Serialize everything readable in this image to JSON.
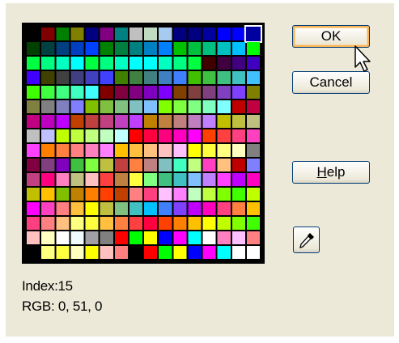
{
  "buttons": {
    "ok": "OK",
    "cancel": "Cancel",
    "help_underlined": "H",
    "help_rest": "elp"
  },
  "info": {
    "index_label": "Index:",
    "index_value": "15",
    "rgb_label": "RGB:",
    "rgb_value": "0, 51, 0"
  },
  "palette": {
    "columns": 16,
    "rows": 16,
    "selected_index": 15,
    "icon": "eyedropper-icon",
    "colors": [
      [
        "#000000",
        "#800000",
        "#008000",
        "#808000",
        "#000080",
        "#800080",
        "#008080",
        "#c0c0c0",
        "#c0dcc0",
        "#a6caf0",
        "#000080",
        "#000080",
        "#0000a0",
        "#0000ff",
        "#0000ff",
        "#003300"
      ],
      [
        "#004000",
        "#004040",
        "#004080",
        "#0040c0",
        "#0040ff",
        "#008000",
        "#008040",
        "#008080",
        "#0080c0",
        "#0080ff",
        "#00c000",
        "#00c040",
        "#00c080",
        "#00c0c0",
        "#00c0ff",
        "#00ff00"
      ],
      [
        "#00ff40",
        "#00ff80",
        "#00ffc0",
        "#00ffff",
        "#00ff40",
        "#00ff80",
        "#00ffc0",
        "#00ffff",
        "#00ffff",
        "#00ffc0",
        "#00ff80",
        "#00ff40",
        "#400000",
        "#400040",
        "#400080",
        "#4000c0"
      ],
      [
        "#4000ff",
        "#404000",
        "#404040",
        "#404080",
        "#4040c0",
        "#4040ff",
        "#408000",
        "#408040",
        "#408080",
        "#4080c0",
        "#4080ff",
        "#40c000",
        "#40c040",
        "#40c080",
        "#40c0c0",
        "#40c0ff"
      ],
      [
        "#40ff00",
        "#40ff40",
        "#40ff80",
        "#40ffc0",
        "#40ffff",
        "#800000",
        "#800040",
        "#800080",
        "#8000c0",
        "#8000ff",
        "#804000",
        "#804040",
        "#804080",
        "#8040c0",
        "#8040ff",
        "#808000"
      ],
      [
        "#808040",
        "#808080",
        "#8080c0",
        "#8080ff",
        "#80c000",
        "#80c040",
        "#80c080",
        "#80c0c0",
        "#80c0ff",
        "#80ff00",
        "#80ff40",
        "#80ff80",
        "#80ffc0",
        "#80ffff",
        "#c00000",
        "#c00040"
      ],
      [
        "#c00080",
        "#c000c0",
        "#c000ff",
        "#c04000",
        "#c04040",
        "#c04080",
        "#c040c0",
        "#c040ff",
        "#c08000",
        "#c08040",
        "#c08080",
        "#c080c0",
        "#c080ff",
        "#c0c000",
        "#c0c040",
        "#c0c080"
      ],
      [
        "#c0c0c0",
        "#c0c0ff",
        "#c0ff00",
        "#c0ff40",
        "#c0ff80",
        "#c0ffc0",
        "#c0ffff",
        "#ff0000",
        "#ff0040",
        "#ff0080",
        "#ff00c0",
        "#ff00ff",
        "#ff4000",
        "#ff4040",
        "#ff4080",
        "#ff40c0"
      ],
      [
        "#ff40ff",
        "#ff8000",
        "#ff8040",
        "#ff8080",
        "#ff80c0",
        "#ff80ff",
        "#ffc000",
        "#ffc040",
        "#ffc080",
        "#ffc0c0",
        "#ffc0ff",
        "#ffff00",
        "#ffff40",
        "#ffff80",
        "#ffffc0",
        "#808080"
      ],
      [
        "#800040",
        "#804080",
        "#8000c0",
        "#40c040",
        "#80ff40",
        "#c0c040",
        "#c04040",
        "#ff8040",
        "#c08080",
        "#80c0c0",
        "#40ffc0",
        "#c0ff80",
        "#ff40c0",
        "#ffc080",
        "#c00000",
        "#8080ff"
      ],
      [
        "#c04080",
        "#ff0080",
        "#ff80c0",
        "#c0c080",
        "#ffc0c0",
        "#ff4040",
        "#c08040",
        "#ffff40",
        "#80ff80",
        "#40c080",
        "#40c0c0",
        "#80c0ff",
        "#c080ff",
        "#ff40ff",
        "#c000ff",
        "#ff00c0"
      ],
      [
        "#c0c000",
        "#ffc000",
        "#80c000",
        "#c08000",
        "#ff8000",
        "#ff4000",
        "#c04000",
        "#ff8080",
        "#ff4080",
        "#ffc0ff",
        "#ff80ff",
        "#c0ffc0",
        "#c0ff40",
        "#80ff00",
        "#40ff00",
        "#c0ff00"
      ],
      [
        "#ff00ff",
        "#ff40c0",
        "#ff8080",
        "#ffc040",
        "#ffff00",
        "#c0c040",
        "#80c080",
        "#40c0c0",
        "#00c0ff",
        "#4080ff",
        "#8040ff",
        "#c000ff",
        "#ff00c0",
        "#ff4080",
        "#ff8040",
        "#ffc000"
      ],
      [
        "#ff4080",
        "#ff8080",
        "#ffc080",
        "#ffff80",
        "#ffff40",
        "#ffc040",
        "#ff8040",
        "#ff4040",
        "#ff0040",
        "#ff4000",
        "#ff8000",
        "#ffc000",
        "#ffff00",
        "#c0ff00",
        "#80ff00",
        "#40ff00"
      ],
      [
        "#ffc0c0",
        "#ffffc0",
        "#ffffff",
        "#f0fbff",
        "#a0a0a4",
        "#808080",
        "#ff0000",
        "#00ff00",
        "#ffff00",
        "#0000ff",
        "#ff00ff",
        "#00ffff",
        "#ffffff",
        "#ff80c0",
        "#ffc0ff",
        "#ff8080"
      ],
      [
        "#000000",
        "#ffff80",
        "#ffff40",
        "#ffffc0",
        "#ffff00",
        "#ffc0c0",
        "#ff8080",
        "#000000",
        "#ff0000",
        "#00ff00",
        "#ffff00",
        "#0000ff",
        "#ff00ff",
        "#00ffff",
        "#ffffff",
        "#ffffff"
      ]
    ]
  }
}
